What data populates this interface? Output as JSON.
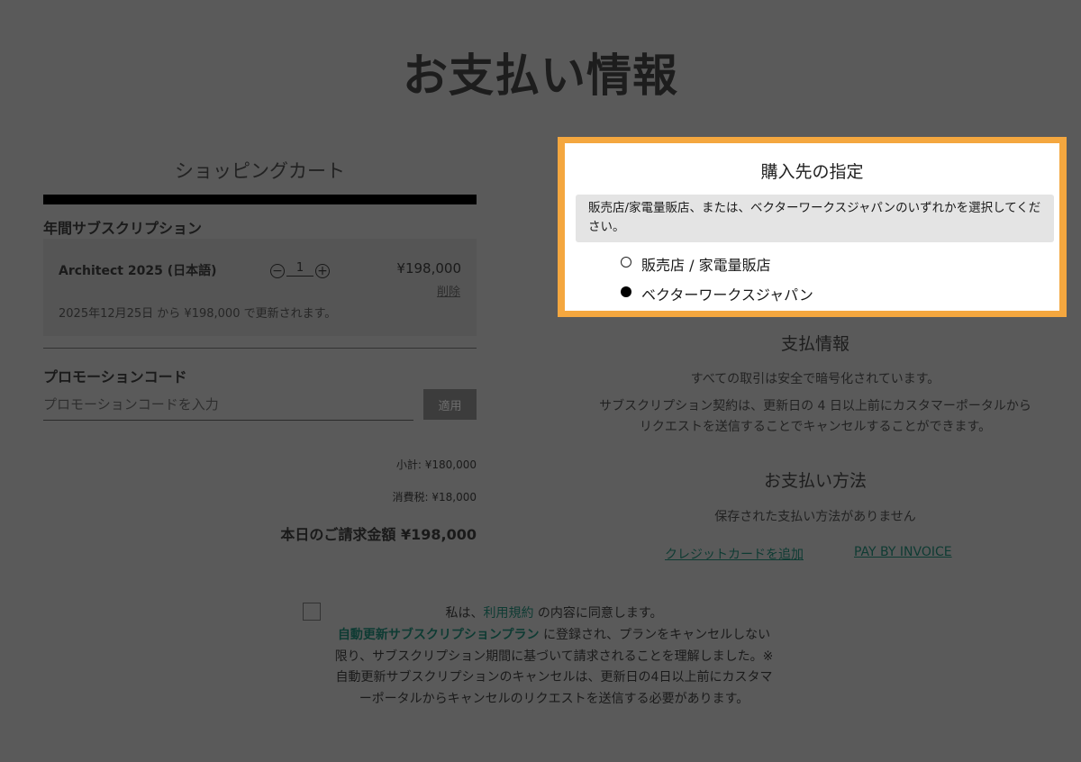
{
  "page": {
    "title": "お支払い情報"
  },
  "cart": {
    "title": "ショッピングカート",
    "section_label": "年間サブスクリプション",
    "item": {
      "name": "Architect 2025 (日本語)",
      "quantity": "1",
      "price": "¥198,000",
      "delete_label": "削除",
      "renewal_note": "2025年12月25日 から ¥198,000 で更新されます。"
    },
    "promo": {
      "heading": "プロモーションコード",
      "placeholder": "プロモーションコードを入力",
      "apply_label": "適用"
    },
    "subtotal": "小計: ¥180,000",
    "tax": "消費税: ¥18,000",
    "total": "本日のご請求金額 ¥198,000"
  },
  "purchase_source": {
    "title": "購入先の指定",
    "notice": "販売店/家電量販店、または、ベクターワークスジャパンのいずれかを選択してください。",
    "options": [
      {
        "label": "販売店 / 家電量販店",
        "selected": false
      },
      {
        "label": "ベクターワークスジャパン",
        "selected": true
      }
    ]
  },
  "payment_info": {
    "title": "支払情報",
    "secure_text": "すべての取引は安全で暗号化されています。",
    "cancel_text": "サブスクリプション契約は、更新日の 4 日以上前にカスタマーポータルからリクエストを送信することでキャンセルすることができます。"
  },
  "payment_method": {
    "title": "お支払い方法",
    "empty_text": "保存された支払い方法がありません",
    "add_card_label": "クレジットカードを追加",
    "invoice_label": "PAY BY INVOICE"
  },
  "terms": {
    "prefix": "私は、",
    "terms_link": "利用規約",
    "suffix": " の内容に同意します。",
    "plan_link": "自動更新サブスクリプションプラン",
    "body": " に登録され、プランをキャンセルしない限り、サブスクリプション期間に基づいて請求されることを理解しました。※自動更新サブスクリプションのキャンセルは、更新日の4日以上前にカスタマーポータルからキャンセルのリクエストを送信する必要があります。"
  },
  "colors": {
    "overlay": "#5a5a5a",
    "highlight": "#f4a73f",
    "link": "#0e3b33"
  }
}
